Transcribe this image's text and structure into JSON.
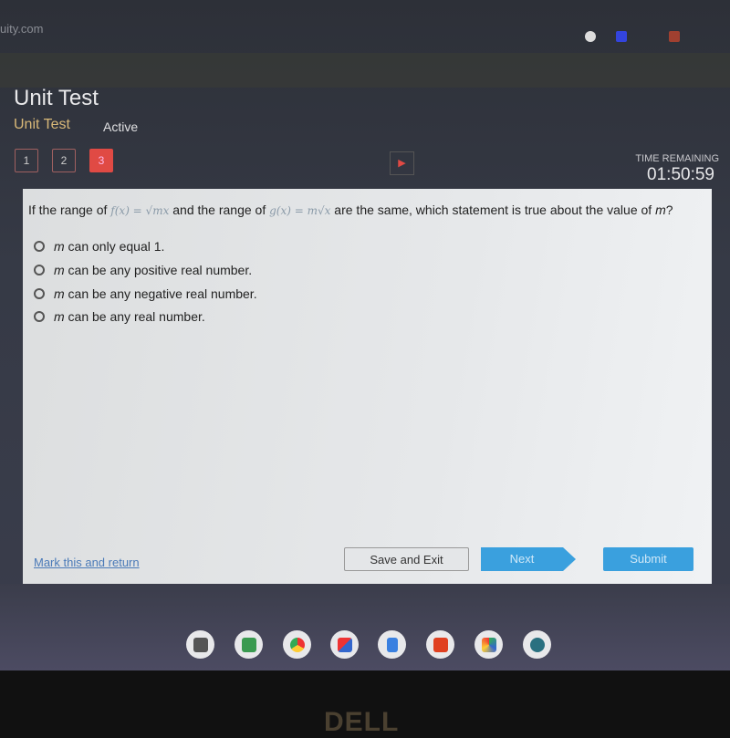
{
  "browser": {
    "url_fragment": "uity.com"
  },
  "header": {
    "title": "Unit Test",
    "subtitle": "Unit Test",
    "status": "Active"
  },
  "nav": {
    "questions": [
      "1",
      "2",
      "3"
    ],
    "current": "3"
  },
  "timer": {
    "label": "TIME REMAINING",
    "value": "01:50:59"
  },
  "question": {
    "prefix": "If the range of ",
    "f": "f(x) = √mx",
    "mid": " and the range of ",
    "g": "g(x) = m√x",
    "suffix": " are the same, which statement is true about the value of ",
    "var": "m",
    "end": "?",
    "options": [
      {
        "var": "m",
        "text": " can only equal 1."
      },
      {
        "var": "m",
        "text": " can be any positive real number."
      },
      {
        "var": "m",
        "text": " can be any negative real number."
      },
      {
        "var": "m",
        "text": " can be any real number."
      }
    ]
  },
  "footer": {
    "mark_label": "Mark this and return",
    "save_label": "Save and Exit",
    "next_label": "Next",
    "submit_label": "Submit"
  },
  "shelf": {
    "apps": [
      "calculator",
      "classroom",
      "chrome",
      "gmail",
      "docs",
      "youtube",
      "play-store",
      "settings"
    ]
  },
  "bezel": {
    "logo": "DELL"
  },
  "colors": {
    "accent": "#3aa0de",
    "active_question": "#e04a44",
    "subtitle": "#d8b878"
  }
}
